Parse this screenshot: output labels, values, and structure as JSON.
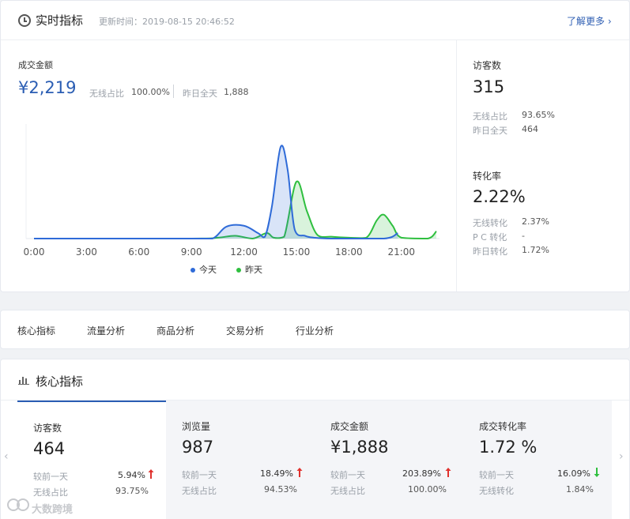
{
  "realtime": {
    "title": "实时指标",
    "updated": "更新时间：2019-08-15 20:46:52",
    "more_link": "了解更多"
  },
  "amount": {
    "label": "成交金额",
    "value": "¥2,219",
    "wireless_label": "无线占比",
    "wireless_value": "100.00%",
    "yesterday_label": "昨日全天",
    "yesterday_value": "1,888"
  },
  "visitors": {
    "label": "访客数",
    "value": "315",
    "wireless_label": "无线占比",
    "wireless_value": "93.65%",
    "yesterday_label": "昨日全天",
    "yesterday_value": "464"
  },
  "conversion": {
    "label": "转化率",
    "value": "2.22%",
    "wireless_label": "无线转化",
    "wireless_value": "2.37%",
    "pc_label": "P C 转化",
    "pc_value": "-",
    "yesterday_label": "昨日转化",
    "yesterday_value": "1.72%"
  },
  "chart_data": {
    "type": "area",
    "x_ticks": [
      "0:00",
      "3:00",
      "6:00",
      "9:00",
      "12:00",
      "15:00",
      "18:00",
      "21:00"
    ],
    "x_range": [
      0,
      23
    ],
    "y_range": [
      0,
      100
    ],
    "series": [
      {
        "name": "今天",
        "color": "#2f6bd8",
        "points": [
          [
            0,
            0
          ],
          [
            9,
            0
          ],
          [
            10.2,
            0
          ],
          [
            11,
            13
          ],
          [
            12,
            14
          ],
          [
            12.8,
            6
          ],
          [
            13.2,
            2
          ],
          [
            13.6,
            35
          ],
          [
            14.1,
            100
          ],
          [
            14.5,
            75
          ],
          [
            14.9,
            10
          ],
          [
            15.5,
            3
          ],
          [
            16,
            1
          ],
          [
            17,
            0
          ],
          [
            20,
            0
          ],
          [
            20.8,
            6
          ]
        ]
      },
      {
        "name": "昨天",
        "color": "#2fbf3f",
        "points": [
          [
            0,
            0
          ],
          [
            9,
            0
          ],
          [
            10.5,
            1
          ],
          [
            11.5,
            3
          ],
          [
            12.5,
            0
          ],
          [
            13.3,
            6
          ],
          [
            13.7,
            1
          ],
          [
            14.3,
            2
          ],
          [
            15,
            62
          ],
          [
            15.6,
            30
          ],
          [
            16.2,
            4
          ],
          [
            17,
            2
          ],
          [
            18,
            1
          ],
          [
            19,
            1
          ],
          [
            19.6,
            20
          ],
          [
            20,
            26
          ],
          [
            20.5,
            14
          ],
          [
            21,
            1
          ],
          [
            22.5,
            0
          ],
          [
            23,
            8
          ]
        ]
      }
    ]
  },
  "tabs": [
    "核心指标",
    "流量分析",
    "商品分析",
    "交易分析",
    "行业分析"
  ],
  "core": {
    "title": "核心指标",
    "cards": [
      {
        "label": "访客数",
        "value": "464",
        "compare_label": "较前一天",
        "compare_value": "5.94%",
        "trend": "up",
        "wireless_label": "无线占比",
        "wireless_value": "93.75%"
      },
      {
        "label": "浏览量",
        "value": "987",
        "compare_label": "较前一天",
        "compare_value": "18.49%",
        "trend": "up",
        "wireless_label": "无线占比",
        "wireless_value": "94.53%"
      },
      {
        "label": "成交金额",
        "value": "¥1,888",
        "compare_label": "较前一天",
        "compare_value": "203.89%",
        "trend": "up",
        "wireless_label": "无线占比",
        "wireless_value": "100.00%"
      },
      {
        "label": "成交转化率",
        "value": "1.72 %",
        "compare_label": "较前一天",
        "compare_value": "16.09%",
        "trend": "down",
        "wireless_label": "无线转化",
        "wireless_value": "1.84%"
      }
    ]
  },
  "watermark": "大数跨境",
  "colors": {
    "accent": "#2a5db3",
    "up": "#e0312d",
    "down": "#2fbf3f"
  }
}
